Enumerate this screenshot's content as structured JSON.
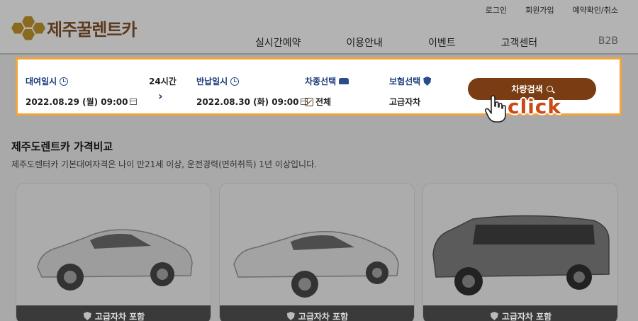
{
  "header": {
    "top_links": [
      "로그인",
      "회원가입",
      "예약확인/취소"
    ],
    "logo_text": "제주꿀렌트카",
    "nav": [
      "실시간예약",
      "이용안내",
      "이벤트",
      "고객센터"
    ],
    "b2b": "B2B"
  },
  "search": {
    "pickup_label": "대여일시",
    "pickup_value": "2022.08.29 (월) 09:00",
    "duration": "24시간",
    "return_label": "반납일시",
    "return_value": "2022.08.30 (화) 09:00",
    "cartype_label": "차종선택",
    "cartype_value": "전체",
    "insurance_label": "보험선택",
    "insurance_value": "고급자차",
    "button_label": "차량검색"
  },
  "annotation": {
    "click_text": "click"
  },
  "section": {
    "title": "제주도렌트카 가격비교",
    "description": "제주도렌터카 기본대여자격은 나이 만21세 이상, 운전경력(면허취득) 1년 이상입니다."
  },
  "cards": [
    {
      "footer": "고급자차 포함"
    },
    {
      "footer": "고급자차 포함"
    },
    {
      "footer": "고급자차 포함"
    }
  ],
  "colors": {
    "accent": "#7a3c12",
    "highlight_border": "#f4a43a",
    "label_blue": "#1a3a7a"
  }
}
